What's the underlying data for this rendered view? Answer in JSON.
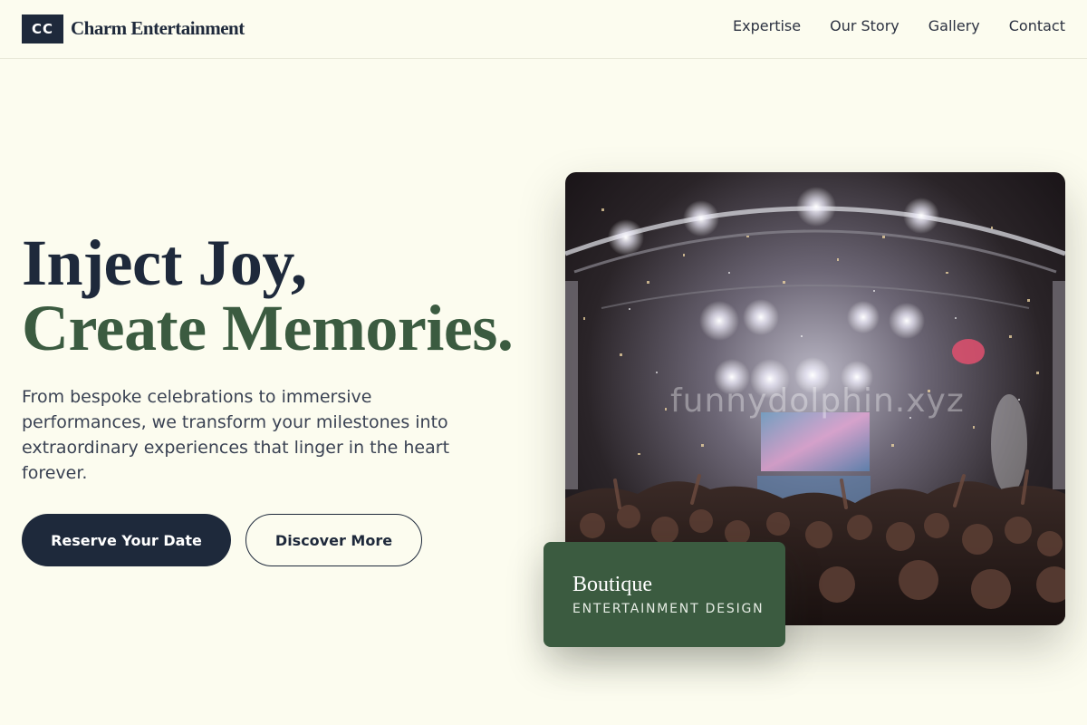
{
  "header": {
    "logo_badge": "CC",
    "brand": "Charm Entertainment",
    "nav": [
      "Expertise",
      "Our Story",
      "Gallery",
      "Contact"
    ]
  },
  "hero": {
    "headline_line1": "Inject Joy,",
    "headline_line2": "Create Memories.",
    "subtext": "From bespoke celebrations to immersive performances, we transform your milestones into extraordinary experiences that linger in the heart forever.",
    "primary_button": "Reserve Your Date",
    "secondary_button": "Discover More"
  },
  "image": {
    "watermark": "funnydolphin.xyz"
  },
  "badge": {
    "title": "Boutique",
    "subtitle": "ENTERTAINMENT DESIGN"
  },
  "colors": {
    "background": "#fcfcef",
    "navy": "#1e293b",
    "green": "#3b5b40"
  },
  "icons": [
    "logo-badge"
  ]
}
